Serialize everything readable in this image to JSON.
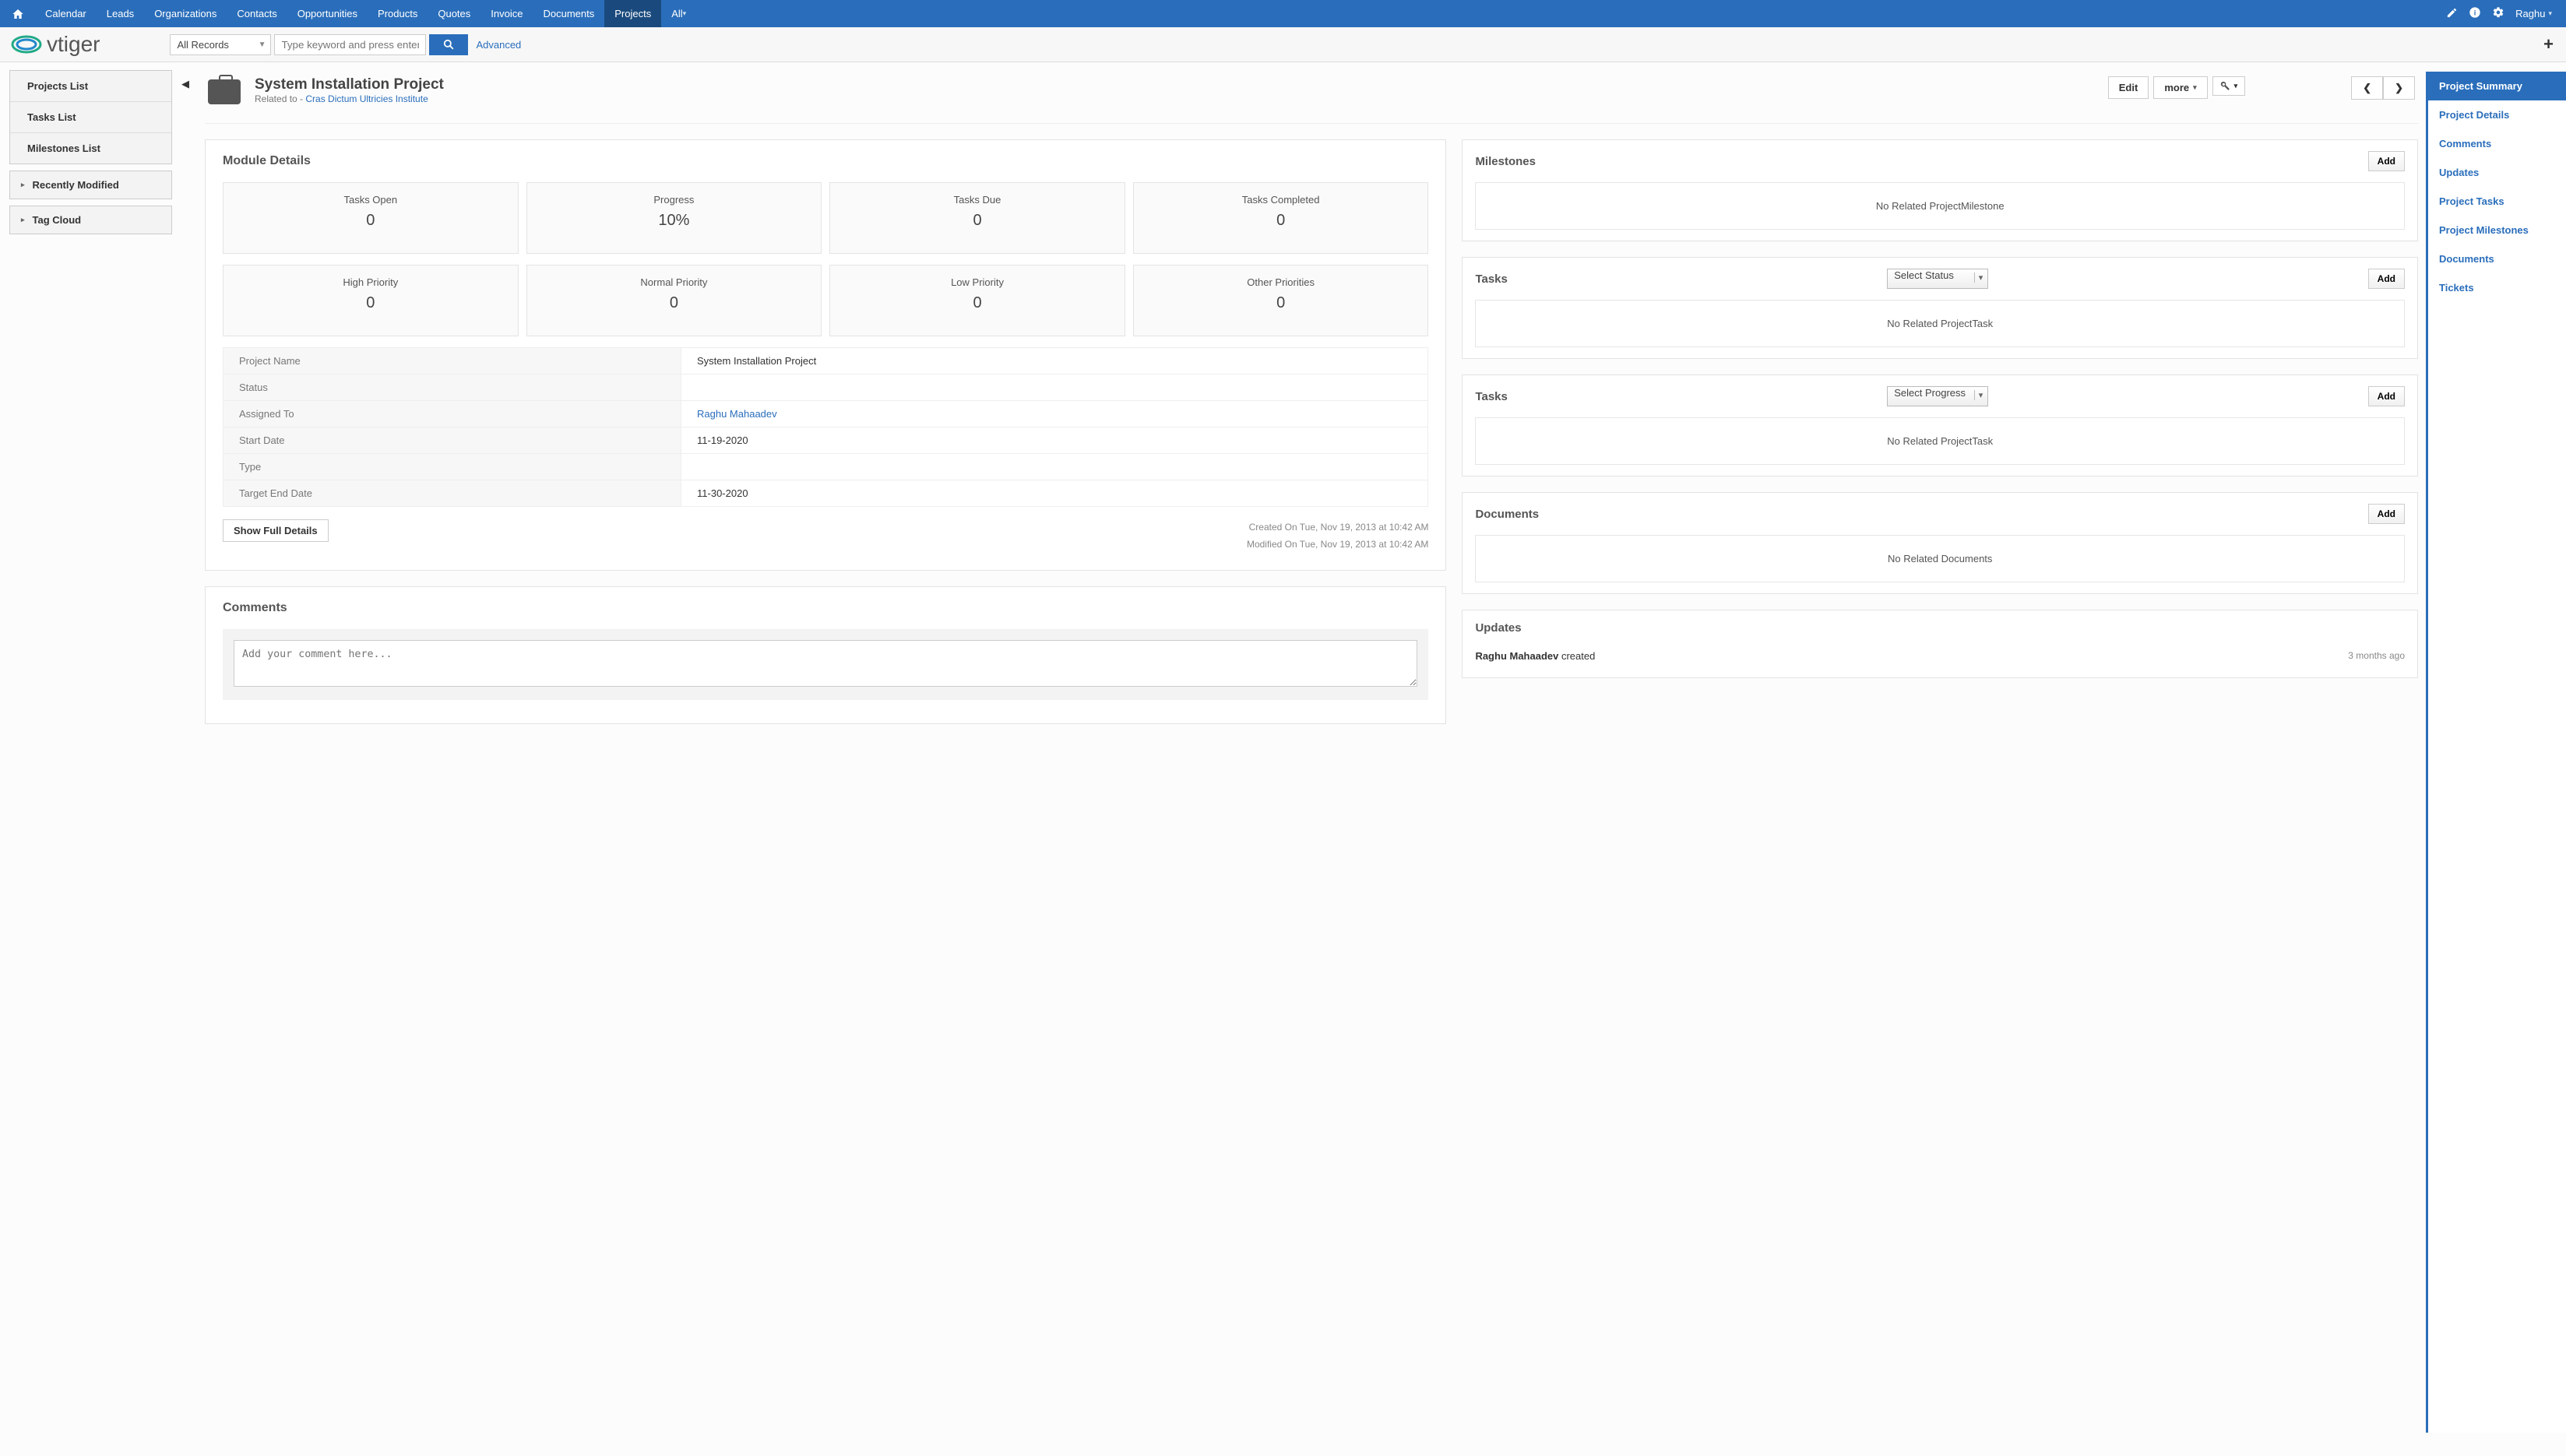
{
  "topnav": {
    "items": [
      "Calendar",
      "Leads",
      "Organizations",
      "Contacts",
      "Opportunities",
      "Products",
      "Quotes",
      "Invoice",
      "Documents",
      "Projects",
      "All"
    ],
    "active_index": 9,
    "user": "Raghu"
  },
  "toolbar": {
    "logo_text": "vtiger",
    "record_scope": "All Records",
    "search_placeholder": "Type keyword and press enter",
    "advanced_label": "Advanced"
  },
  "left_sidebar": {
    "lists": [
      "Projects List",
      "Tasks List",
      "Milestones List"
    ],
    "expandables": [
      "Recently Modified",
      "Tag Cloud"
    ]
  },
  "record": {
    "title": "System Installation Project",
    "related_label": "Related to - ",
    "related_to": "Cras Dictum Ultricies Institute",
    "edit_label": "Edit",
    "more_label": "more"
  },
  "module_details": {
    "heading": "Module Details",
    "stats_row1": [
      {
        "label": "Tasks Open",
        "value": "0"
      },
      {
        "label": "Progress",
        "value": "10%"
      },
      {
        "label": "Tasks Due",
        "value": "0"
      },
      {
        "label": "Tasks Completed",
        "value": "0"
      }
    ],
    "stats_row2": [
      {
        "label": "High Priority",
        "value": "0"
      },
      {
        "label": "Normal Priority",
        "value": "0"
      },
      {
        "label": "Low Priority",
        "value": "0"
      },
      {
        "label": "Other Priorities",
        "value": "0"
      }
    ],
    "fields": [
      {
        "label": "Project Name",
        "value": "System Installation Project",
        "link": false
      },
      {
        "label": "Status",
        "value": "",
        "link": false
      },
      {
        "label": "Assigned To",
        "value": "Raghu Mahaadev",
        "link": true
      },
      {
        "label": "Start Date",
        "value": "11-19-2020",
        "link": false
      },
      {
        "label": "Type",
        "value": "",
        "link": false
      },
      {
        "label": "Target End Date",
        "value": "11-30-2020",
        "link": false
      }
    ],
    "show_full": "Show Full Details",
    "created": "Created On Tue, Nov 19, 2013 at 10:42 AM",
    "modified": "Modified On Tue, Nov 19, 2013 at 10:42 AM"
  },
  "comments": {
    "heading": "Comments",
    "placeholder": "Add your comment here..."
  },
  "widgets": {
    "milestones": {
      "title": "Milestones",
      "add": "Add",
      "empty": "No Related ProjectMilestone"
    },
    "tasks_status": {
      "title": "Tasks",
      "select": "Select Status",
      "add": "Add",
      "empty": "No Related ProjectTask"
    },
    "tasks_progress": {
      "title": "Tasks",
      "select": "Select Progress",
      "add": "Add",
      "empty": "No Related ProjectTask"
    },
    "documents": {
      "title": "Documents",
      "add": "Add",
      "empty": "No Related Documents"
    },
    "updates": {
      "title": "Updates",
      "rows": [
        {
          "who": "Raghu Mahaadev",
          "action": "created",
          "when": "3 months ago"
        }
      ]
    }
  },
  "right_tabs": {
    "items": [
      "Project Summary",
      "Project Details",
      "Comments",
      "Updates",
      "Project Tasks",
      "Project Milestones",
      "Documents",
      "Tickets"
    ],
    "active_index": 0
  }
}
